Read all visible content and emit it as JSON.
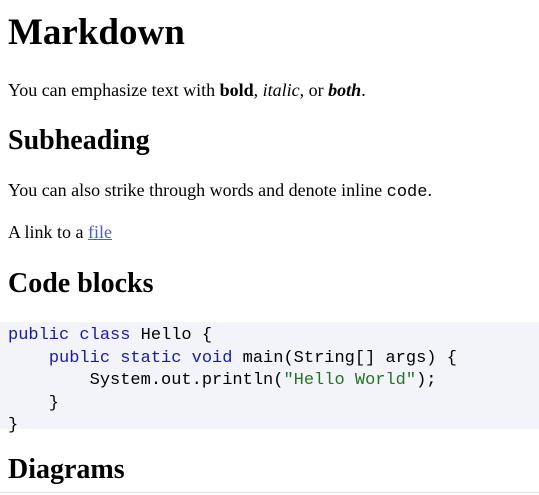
{
  "heading": "Markdown",
  "intro": {
    "prefix": "You can emphasize text with ",
    "bold": "bold",
    "sep1": ", ",
    "italic": "italic",
    "sep2": ", or ",
    "both": "both",
    "suffix": "."
  },
  "subheading": "Subheading",
  "strike_para": {
    "prefix": "You can also strike through words and denote inline ",
    "code": "code",
    "suffix": "."
  },
  "link_para": {
    "prefix": "A link to a ",
    "link_text": "file"
  },
  "code_heading": "Code blocks",
  "code": {
    "line1_kw": "public class",
    "line1_rest": " Hello {",
    "line2_indent": "    ",
    "line2_kw": "public static void",
    "line2_rest": " main(String[] args) {",
    "line3_pre": "        System.out.println(",
    "line3_str": "\"Hello World\"",
    "line3_post": ");",
    "line4": "    }",
    "line5": "}"
  },
  "diagrams_heading": "Diagrams"
}
